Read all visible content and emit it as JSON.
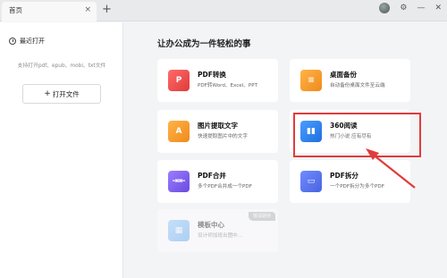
{
  "tab": {
    "label": "首页",
    "close": "×"
  },
  "titlebar": {
    "new_tab": "+",
    "icons": [
      "avatar",
      "settings-icon",
      "minimize-icon",
      "close-icon"
    ],
    "settings": "⚙",
    "minimize": "—",
    "close": "✕"
  },
  "sidebar": {
    "recent_label": "最近打开",
    "support_text": "支持打开pdf、epub、mobi、txt文件",
    "open_button_plus": "+",
    "open_button_label": "打开文件"
  },
  "main": {
    "title": "让办公成为一件轻松的事",
    "cards": [
      {
        "title": "PDF转换",
        "subtitle": "PDF转Word、Excel、PPT",
        "icon": "pdf-convert-icon",
        "glyph": "P",
        "color": "#e84a4a"
      },
      {
        "title": "桌面备份",
        "subtitle": "自动备份桌面文件至云端",
        "icon": "desktop-backup-icon",
        "glyph": "≡",
        "color": "#f59a2e"
      },
      {
        "title": "图片提取文字",
        "subtitle": "快速提取图片中的文字",
        "icon": "image-to-text-icon",
        "glyph": "A",
        "color": "#f59a2e"
      },
      {
        "title": "360阅读",
        "subtitle": "热门小说 应有尽有",
        "icon": "book-icon",
        "glyph": "▮▮",
        "color": "#2f86f0"
      },
      {
        "title": "PDF合并",
        "subtitle": "多个PDF合并成一个PDF",
        "icon": "pdf-merge-icon",
        "glyph": "⇥⇤",
        "color": "#7a5cf0"
      },
      {
        "title": "PDF拆分",
        "subtitle": "一个PDF拆分为多个PDF",
        "icon": "pdf-split-icon",
        "glyph": "▭",
        "color": "#5a76f0"
      },
      {
        "title": "模板中心",
        "subtitle": "设计师加班出图中...",
        "icon": "template-icon",
        "glyph": "▦",
        "color": "#7fb8f5",
        "badge": "敬请期待"
      }
    ]
  },
  "annotation": {
    "highlight_color": "#e23b3b"
  }
}
